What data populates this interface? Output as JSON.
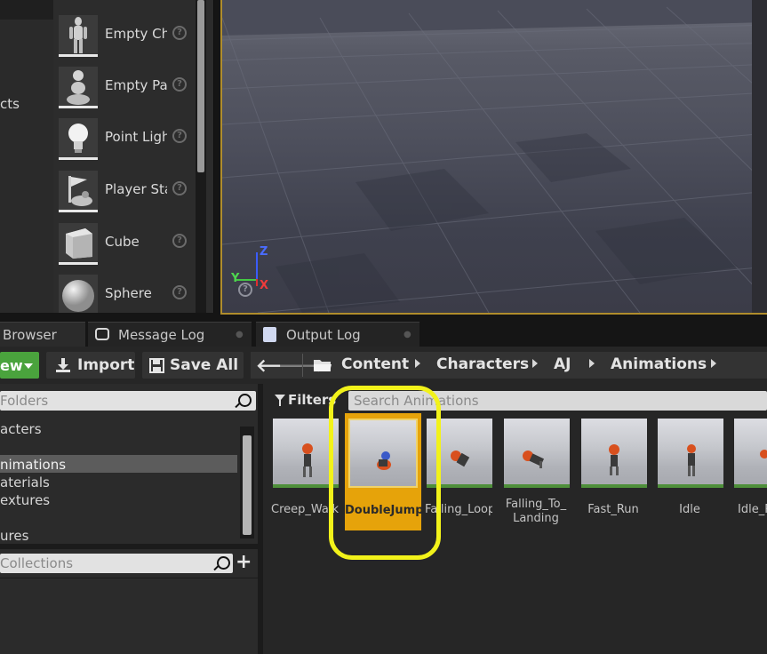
{
  "outliner": {
    "label": "cts"
  },
  "place_actors": [
    {
      "label": "Empty Ch",
      "icon": "mannequin-icon"
    },
    {
      "label": "Empty Pa",
      "icon": "pawn-icon"
    },
    {
      "label": "Point Ligh",
      "icon": "lightbulb-icon"
    },
    {
      "label": "Player Sta",
      "icon": "player-start-icon"
    },
    {
      "label": "Cube",
      "icon": "cube-icon"
    },
    {
      "label": "Sphere",
      "icon": "sphere-icon"
    }
  ],
  "viewport": {
    "axis_z": "Z",
    "axis_y": "Y",
    "axis_x": "X"
  },
  "tabs": [
    {
      "label": "Browser"
    },
    {
      "label": "Message Log"
    },
    {
      "label": "Output Log"
    }
  ],
  "toolbar": {
    "add_new": "ew",
    "import": "Import",
    "save_all": "Save All"
  },
  "breadcrumb": [
    "Content",
    "Characters",
    "AJ",
    "Animations"
  ],
  "sources": {
    "folders_placeholder": "Folders",
    "folders": [
      "acters",
      "nimations",
      "aterials",
      "extures",
      "ures"
    ],
    "selected_folder": "nimations",
    "collections_placeholder": "Collections"
  },
  "assets_panel": {
    "filters_label": "Filters",
    "search_placeholder": "Search Animations",
    "items": [
      {
        "name": "Creep_Walk"
      },
      {
        "name": "DoubleJump"
      },
      {
        "name": "Falling_Loop"
      },
      {
        "name": "Falling_To_ Landing"
      },
      {
        "name": "Fast_Run"
      },
      {
        "name": "Idle"
      },
      {
        "name": "Idle_R"
      }
    ]
  },
  "colors": {
    "selection": "#e6a30a",
    "highlight_ring": "#f2f21a",
    "add_new": "#4aa33d"
  }
}
